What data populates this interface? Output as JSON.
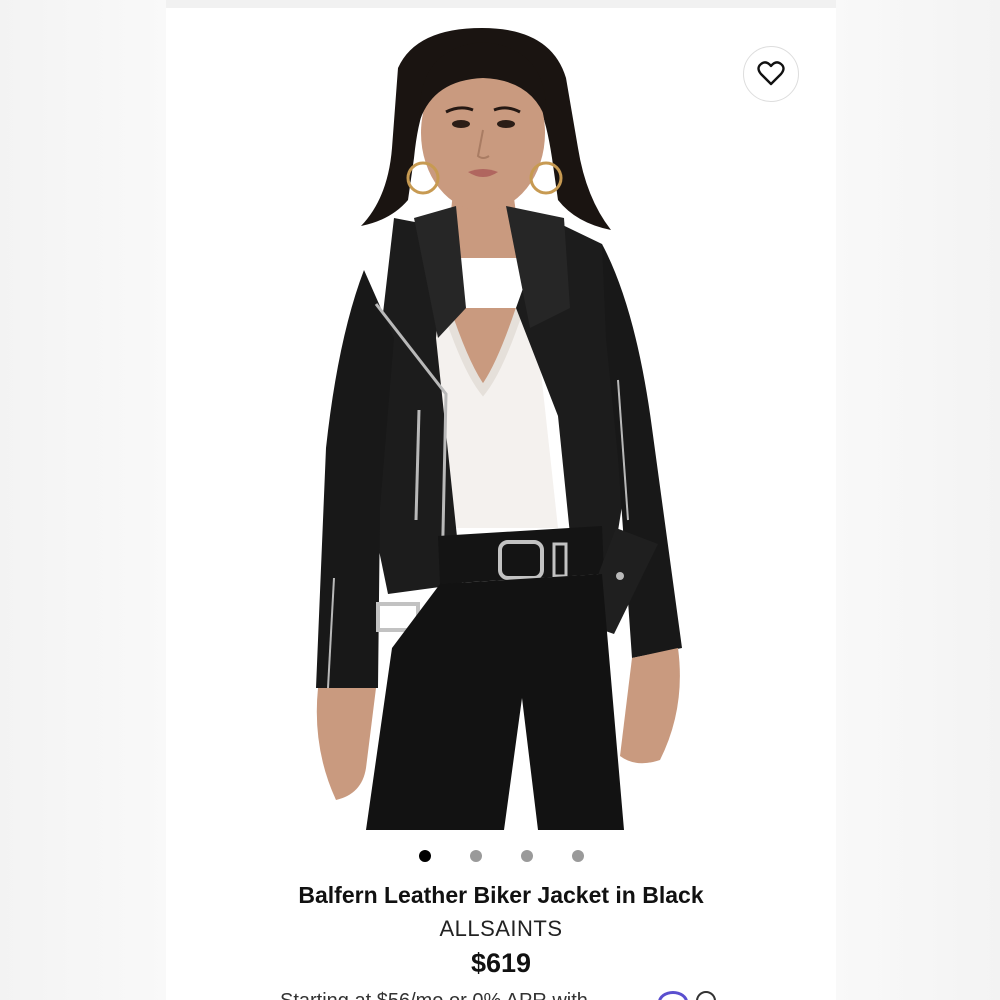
{
  "favorite": {
    "icon": "heart-icon"
  },
  "carousel": {
    "count": 4,
    "active": 1
  },
  "product": {
    "name": "Balfern Leather Biker Jacket in Black",
    "brand": "ALLSAINTS",
    "price": "$619"
  },
  "financing": {
    "text": "Starting at $56/mo or 0% APR with",
    "logo_icon": "affirm-logo-icon",
    "info_icon": "info-icon"
  },
  "colors": {
    "jacket": "#1c1c1c",
    "camisole": "#f4f1ee",
    "jeans": "#121212",
    "skin": "#c99a7f",
    "hair": "#1a1411",
    "hardware": "#b9b9b9",
    "accent": "#5a4fcf"
  }
}
